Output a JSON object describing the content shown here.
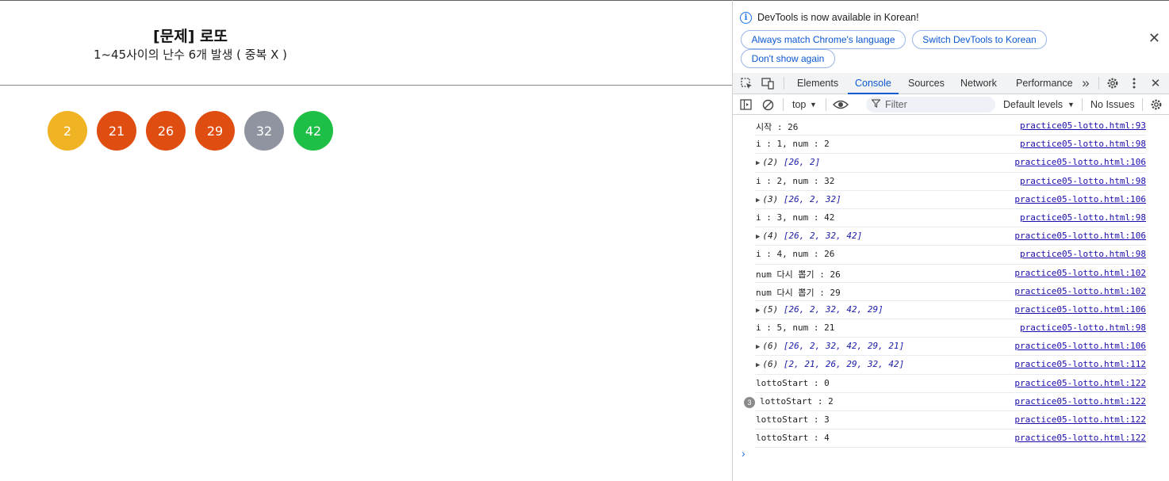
{
  "page": {
    "title": "[문제] 로또",
    "subtitle": "1~45사이의 난수 6개 발생 ( 중복 X )",
    "balls": [
      {
        "value": "2",
        "color": "#f0b323"
      },
      {
        "value": "21",
        "color": "#e04d10"
      },
      {
        "value": "26",
        "color": "#e04d10"
      },
      {
        "value": "29",
        "color": "#e04d10"
      },
      {
        "value": "32",
        "color": "#9094a0"
      },
      {
        "value": "42",
        "color": "#1dbf47"
      }
    ]
  },
  "devtools": {
    "infobar": {
      "message": "DevTools is now available in Korean!",
      "btn_match": "Always match Chrome's language",
      "btn_switch": "Switch DevTools to Korean",
      "btn_dont_show": "Don't show again",
      "close": "✕"
    },
    "tabs": [
      "Elements",
      "Console",
      "Sources",
      "Network",
      "Performance"
    ],
    "active_tab": "Console",
    "more": "»",
    "toolbar": {
      "context": "top",
      "filter_placeholder": "Filter",
      "levels": "Default levels",
      "issues": "No Issues"
    },
    "log": [
      {
        "type": "text",
        "msg": "시작 : 26",
        "src": "practice05-lotto.html:93"
      },
      {
        "type": "text",
        "msg": "i : 1, num : 2",
        "src": "practice05-lotto.html:98"
      },
      {
        "type": "obj",
        "len": "(2)",
        "arr": "[26, 2]",
        "src": "practice05-lotto.html:106"
      },
      {
        "type": "text",
        "msg": "i : 2, num : 32",
        "src": "practice05-lotto.html:98"
      },
      {
        "type": "obj",
        "len": "(3)",
        "arr": "[26, 2, 32]",
        "src": "practice05-lotto.html:106"
      },
      {
        "type": "text",
        "msg": "i : 3, num : 42",
        "src": "practice05-lotto.html:98"
      },
      {
        "type": "obj",
        "len": "(4)",
        "arr": "[26, 2, 32, 42]",
        "src": "practice05-lotto.html:106"
      },
      {
        "type": "text",
        "msg": "i : 4, num : 26",
        "src": "practice05-lotto.html:98"
      },
      {
        "type": "text",
        "msg": "num 다시 뽑기 : 26",
        "src": "practice05-lotto.html:102"
      },
      {
        "type": "text",
        "msg": "num 다시 뽑기 : 29",
        "src": "practice05-lotto.html:102"
      },
      {
        "type": "obj",
        "len": "(5)",
        "arr": "[26, 2, 32, 42, 29]",
        "src": "practice05-lotto.html:106"
      },
      {
        "type": "text",
        "msg": "i : 5, num : 21",
        "src": "practice05-lotto.html:98"
      },
      {
        "type": "obj",
        "len": "(6)",
        "arr": "[26, 2, 32, 42, 29, 21]",
        "src": "practice05-lotto.html:106"
      },
      {
        "type": "obj",
        "len": "(6)",
        "arr": "[2, 21, 26, 29, 32, 42]",
        "src": "practice05-lotto.html:112"
      },
      {
        "type": "text",
        "msg": "lottoStart : 0",
        "src": "practice05-lotto.html:122"
      },
      {
        "type": "text",
        "msg": "lottoStart : 2",
        "src": "practice05-lotto.html:122",
        "count": "3"
      },
      {
        "type": "text",
        "msg": "lottoStart : 3",
        "src": "practice05-lotto.html:122"
      },
      {
        "type": "text",
        "msg": "lottoStart : 4",
        "src": "practice05-lotto.html:122"
      }
    ],
    "prompt": "›"
  }
}
